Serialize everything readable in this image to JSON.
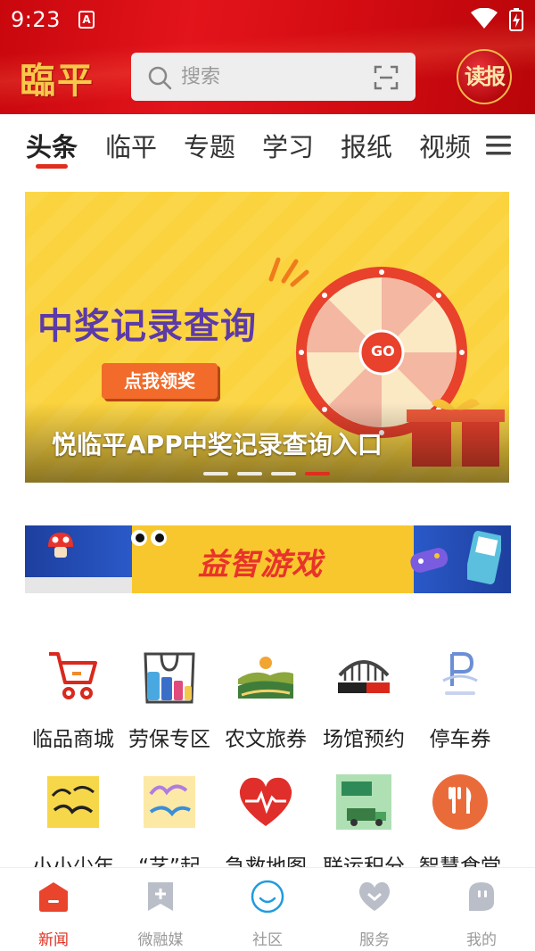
{
  "status_bar": {
    "time": "9:23",
    "notif_glyph": "A"
  },
  "header": {
    "logo_text": "臨平",
    "search_placeholder": "搜索",
    "read_button_label": "读报"
  },
  "tabs": [
    {
      "label": "头条",
      "active": true
    },
    {
      "label": "临平",
      "active": false
    },
    {
      "label": "专题",
      "active": false
    },
    {
      "label": "学习",
      "active": false
    },
    {
      "label": "报纸",
      "active": false
    },
    {
      "label": "视频",
      "active": false
    }
  ],
  "banner": {
    "headline": "中奖记录查询",
    "cta": "点我领奖",
    "wheel_center": "GO",
    "caption": "悦临平APP中奖记录查询入口",
    "slide_count": 4,
    "active_slide": 4
  },
  "game_banner": {
    "title": "益智游戏"
  },
  "services": [
    {
      "label": "临品商城",
      "icon": "cart-icon"
    },
    {
      "label": "劳保专区",
      "icon": "shopping-bag-icon"
    },
    {
      "label": "农文旅券",
      "icon": "landscape-icon"
    },
    {
      "label": "场馆预约",
      "icon": "stadium-icon"
    },
    {
      "label": "停车券",
      "icon": "parking-icon"
    },
    {
      "label": "小小少年",
      "icon": "youth-icon"
    },
    {
      "label": "“艺”起",
      "icon": "art-icon"
    },
    {
      "label": "急救地图",
      "icon": "heart-pulse-icon"
    },
    {
      "label": "联运积分",
      "icon": "recycle-truck-icon"
    },
    {
      "label": "智慧食堂",
      "icon": "fork-knife-icon"
    }
  ],
  "bottom_nav": [
    {
      "label": "新闻",
      "icon": "home-icon",
      "active": true
    },
    {
      "label": "微融媒",
      "icon": "bookmark-plus-icon",
      "active": false
    },
    {
      "label": "社区",
      "icon": "smile-circle-icon",
      "active": false
    },
    {
      "label": "服务",
      "icon": "heart-check-icon",
      "active": false
    },
    {
      "label": "我的",
      "icon": "profile-icon",
      "active": false
    }
  ],
  "colors": {
    "header_red": "#d30c12",
    "accent": "#e02e1e",
    "banner_yellow": "#fbd33e",
    "banner_purple": "#5c3aa8"
  }
}
